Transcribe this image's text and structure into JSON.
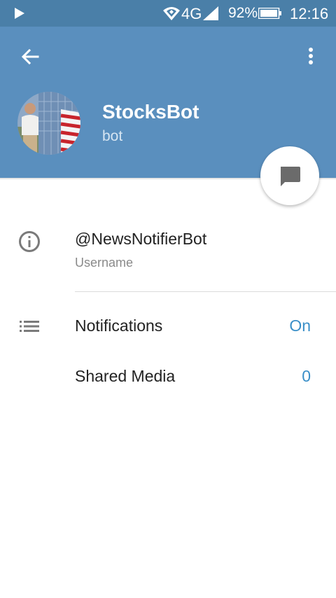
{
  "status_bar": {
    "network": "4G",
    "battery_percent": "92%",
    "time": "12:16"
  },
  "header": {
    "title": "StocksBot",
    "subtitle": "bot"
  },
  "info": {
    "username_value": "@NewsNotifierBot",
    "username_label": "Username"
  },
  "settings": [
    {
      "label": "Notifications",
      "value": "On"
    },
    {
      "label": "Shared Media",
      "value": "0"
    }
  ],
  "colors": {
    "status_bar_bg": "#4a7fa8",
    "header_bg": "#5a8fbe",
    "accent_blue": "#3a8fc8"
  },
  "icons": {
    "back": "arrow-left-icon",
    "menu": "more-vertical-icon",
    "message": "chat-bubble-icon",
    "info": "info-circle-icon",
    "list": "list-icon"
  }
}
